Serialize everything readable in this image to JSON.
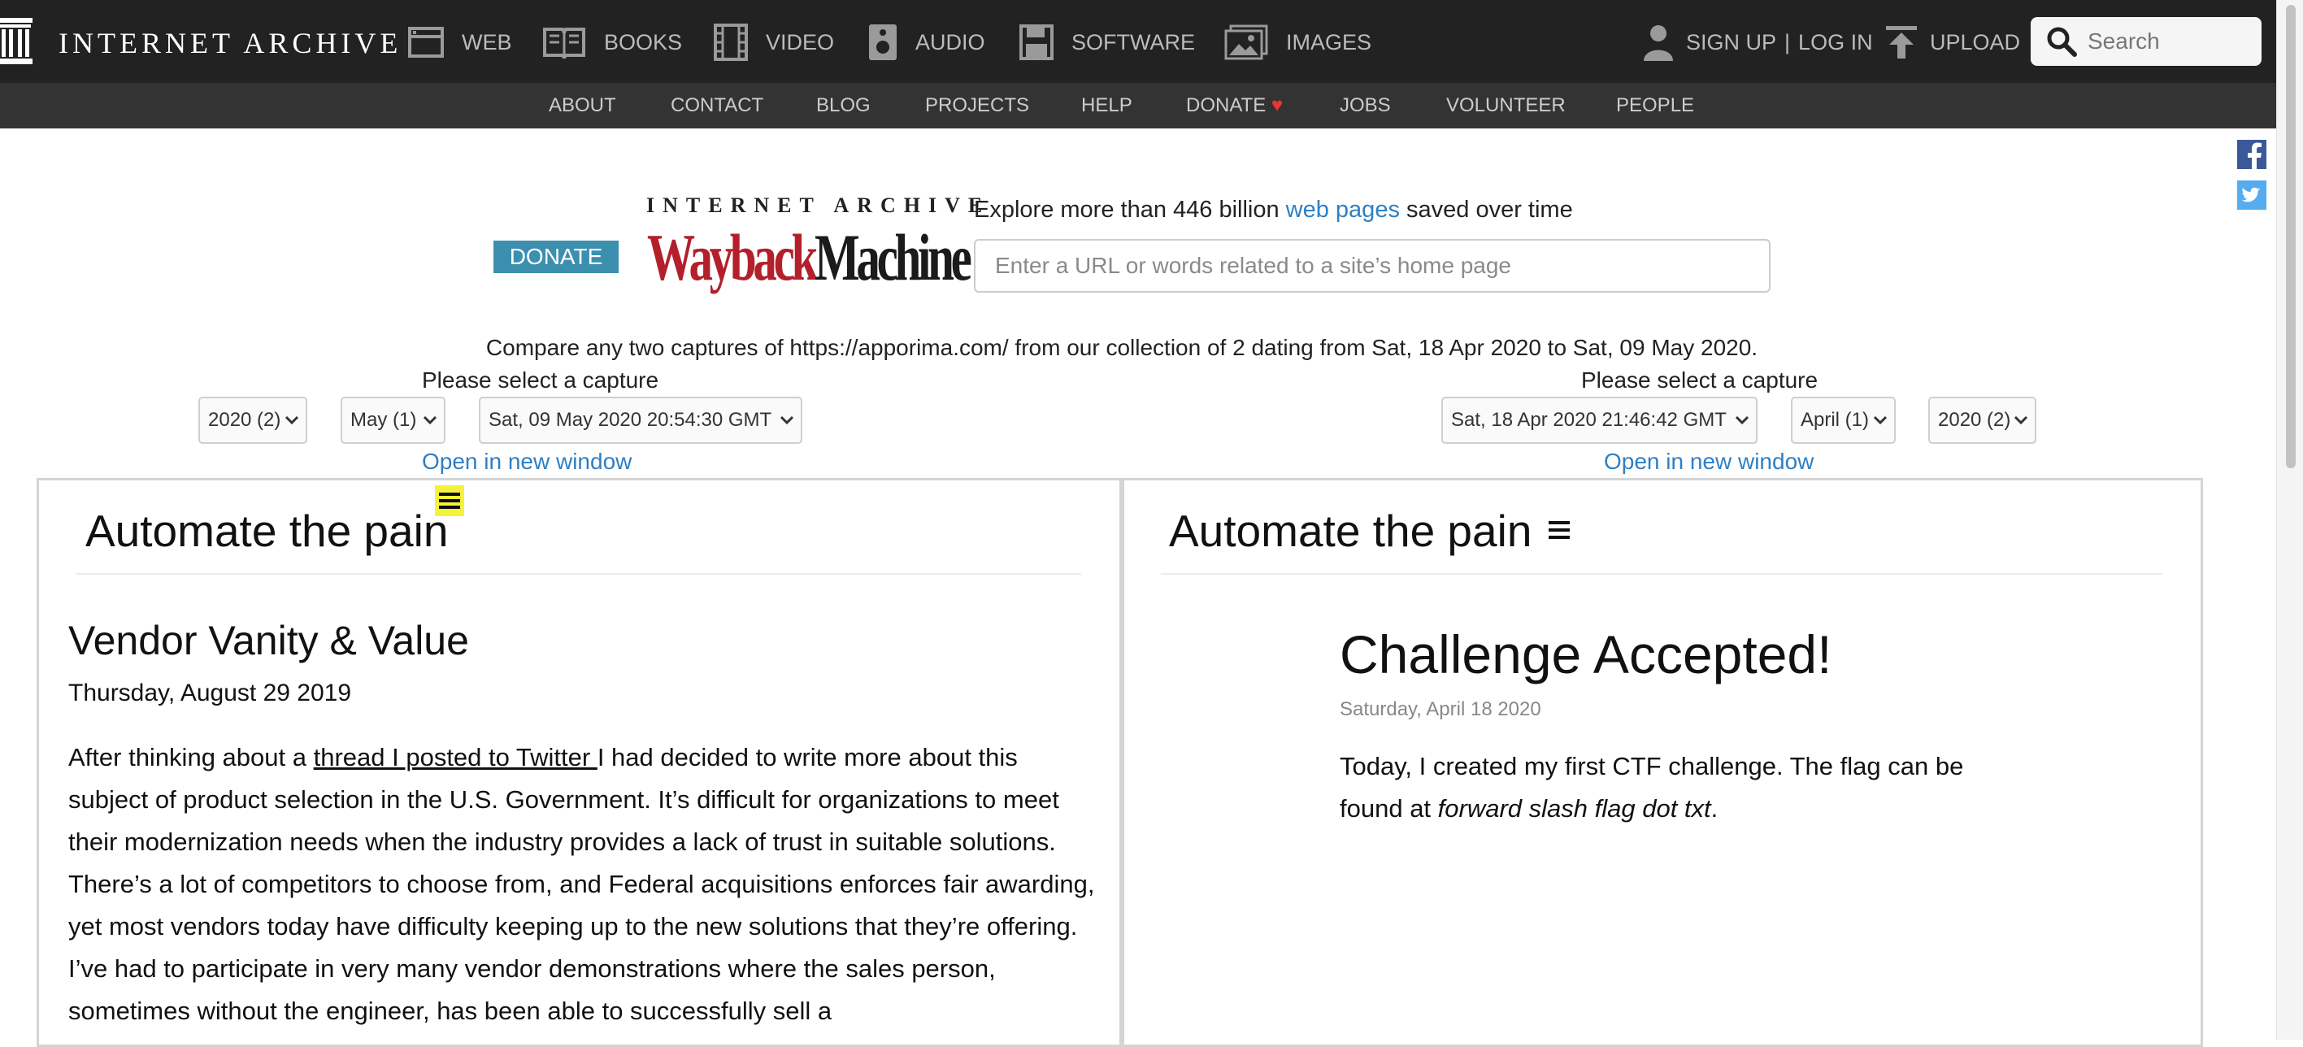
{
  "topbar": {
    "logo_text": "INTERNET ARCHIVE",
    "nav": [
      {
        "label": "WEB",
        "icon": "web-icon"
      },
      {
        "label": "BOOKS",
        "icon": "books-icon"
      },
      {
        "label": "VIDEO",
        "icon": "video-icon"
      },
      {
        "label": "AUDIO",
        "icon": "audio-icon"
      },
      {
        "label": "SOFTWARE",
        "icon": "software-icon"
      },
      {
        "label": "IMAGES",
        "icon": "images-icon"
      }
    ],
    "sign_up": "SIGN UP",
    "separator": "|",
    "log_in": "LOG IN",
    "upload": "UPLOAD",
    "search_placeholder": "Search"
  },
  "subnav": {
    "items": [
      "ABOUT",
      "CONTACT",
      "BLOG",
      "PROJECTS",
      "HELP",
      "DONATE",
      "JOBS",
      "VOLUNTEER",
      "PEOPLE"
    ],
    "donate_heart": "♥"
  },
  "wayback": {
    "donate_label": "DONATE",
    "logo_top": "INTERNET ARCHIVE",
    "logo_wayback": "Wayback",
    "logo_machine": "Machine",
    "explore_prefix": "Explore more than 446 billion ",
    "explore_link": "web pages",
    "explore_suffix": " saved over time",
    "url_placeholder": "Enter a URL or words related to a site’s home page",
    "compare_text": "Compare any two captures of https://apporima.com/ from our collection of 2 dating from Sat, 18 Apr 2020 to Sat, 09 May 2020."
  },
  "left_capture": {
    "please_select": "Please select a capture",
    "year": "2020 (2)",
    "month": "May (1)",
    "timestamp": "Sat, 09 May 2020 20:54:30 GMT",
    "open_new": "Open in new window"
  },
  "right_capture": {
    "please_select": "Please select a capture",
    "timestamp": "Sat, 18 Apr 2020 21:46:42 GMT",
    "month": "April (1)",
    "year": "2020 (2)",
    "open_new": "Open in new window"
  },
  "left_frame": {
    "site_title": "Automate the pain",
    "post_title": "Vendor Vanity & Value",
    "post_date": "Thursday, August 29 2019",
    "body_prefix": "After thinking about a ",
    "body_link": "thread I posted to Twitter ",
    "body_rest": "I had decided to write more about this subject of product selection in the U.S. Government. It’s difficult for organizations to meet their modernization needs when the industry provides a lack of trust in suitable solutions. There’s a lot of competitors to choose from, and Federal acquisitions enforces fair awarding, yet most vendors today have difficulty keeping up to the new solutions that they’re offering. I’ve had to participate in very many vendor demonstrations where the sales person, sometimes without the engineer, has been able to successfully sell a"
  },
  "right_frame": {
    "site_title": "Automate the pain",
    "post_title": "Challenge Accepted!",
    "post_date": "Saturday, April 18 2020",
    "body_prefix": "Today, I created my first CTF challenge. The flag can be found at ",
    "body_italic": "forward slash flag dot txt",
    "body_suffix": "."
  },
  "colors": {
    "topbar_bg": "#222222",
    "subnav_bg": "#333333",
    "donate_bg": "#3d8fb0",
    "link": "#2f7fc3",
    "wayback_red": "#b3202c",
    "heart": "#e8372c"
  }
}
